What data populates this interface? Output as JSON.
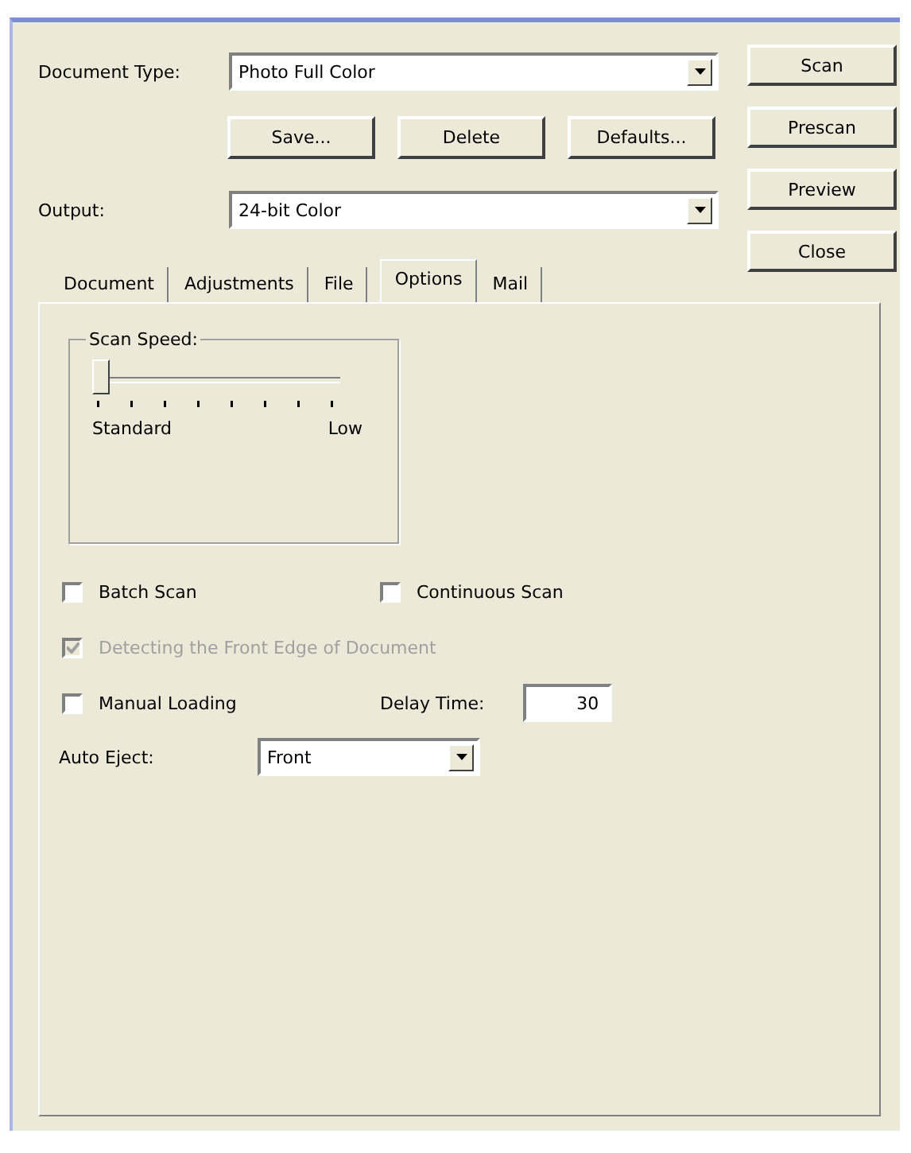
{
  "document_type": {
    "label": "Document Type:",
    "value": "Photo Full Color"
  },
  "preset_buttons": [
    "Save...",
    "Delete",
    "Defaults..."
  ],
  "output": {
    "label": "Output:",
    "value": "24-bit Color"
  },
  "action_buttons": [
    "Scan",
    "Prescan",
    "Preview",
    "Close"
  ],
  "tabs": [
    {
      "label": "Document",
      "selected": false
    },
    {
      "label": "Adjustments",
      "selected": false
    },
    {
      "label": "File",
      "selected": false
    },
    {
      "label": "Options",
      "selected": true
    },
    {
      "label": "Mail",
      "selected": false
    }
  ],
  "scan_speed": {
    "title": "Scan Speed:",
    "level": 0,
    "min_label": "Standard",
    "max_label": "Low"
  },
  "batch_scan": {
    "label": "Batch Scan",
    "checked": false,
    "disabled": false
  },
  "continuous_scan": {
    "label": "Continuous Scan",
    "checked": false,
    "disabled": false
  },
  "front_edge_detection": {
    "label": "Detecting the Front Edge of Document",
    "checked": true,
    "disabled": true
  },
  "manual_loading": {
    "label": "Manual Loading",
    "checked": false,
    "disabled": false
  },
  "delay_time": {
    "label": "Delay Time:",
    "value": "30"
  },
  "auto_eject": {
    "label": "Auto Eject:",
    "value": "Front"
  }
}
